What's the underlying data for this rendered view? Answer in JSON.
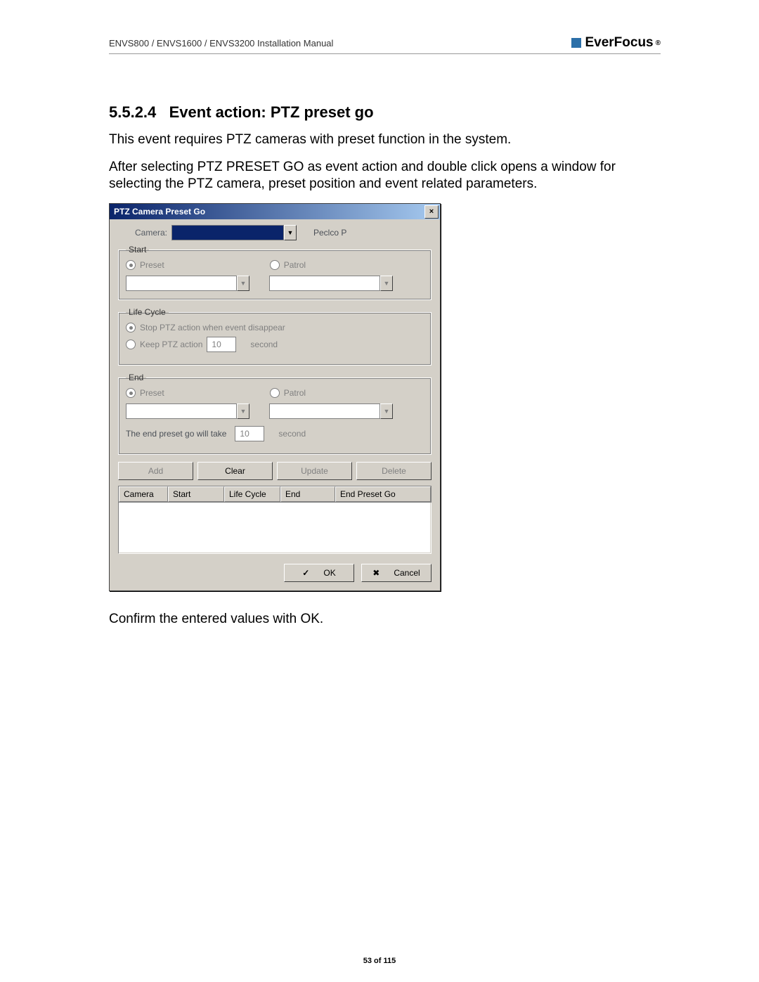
{
  "header": {
    "doc_title": "ENVS800 / ENVS1600 / ENVS3200 Installation Manual",
    "brand_name": "EverFocus",
    "brand_sup": "®"
  },
  "section": {
    "number": "5.5.2.4",
    "title": "Event action: PTZ preset go",
    "para1": "This event requires PTZ cameras with preset function in the system.",
    "para2": "After selecting PTZ PRESET GO  as event action and double click opens a window for selecting the PTZ camera, preset position and event related parameters.",
    "confirm": "Confirm the entered values with OK."
  },
  "dialog": {
    "title": "PTZ Camera Preset Go",
    "close_label": "×",
    "camera_label": "Camera:",
    "camera_protocol": "Peclco P",
    "groups": {
      "start": {
        "legend": "Start",
        "preset_label": "Preset",
        "patrol_label": "Patrol"
      },
      "life": {
        "legend": "Life Cycle",
        "opt_stop": "Stop PTZ action when event disappear",
        "opt_keep": "Keep PTZ action",
        "keep_value": "10",
        "keep_unit": "second"
      },
      "end": {
        "legend": "End",
        "preset_label": "Preset",
        "patrol_label": "Patrol",
        "take_label": "The end preset go will take",
        "take_value": "10",
        "take_unit": "second"
      }
    },
    "buttons": {
      "add": "Add",
      "clear": "Clear",
      "update": "Update",
      "delete": "Delete",
      "ok": "OK",
      "cancel": "Cancel"
    },
    "list_headers": [
      "Camera",
      "Start",
      "Life Cycle",
      "End",
      "End Preset Go"
    ]
  },
  "page_footer": "53 of 115"
}
